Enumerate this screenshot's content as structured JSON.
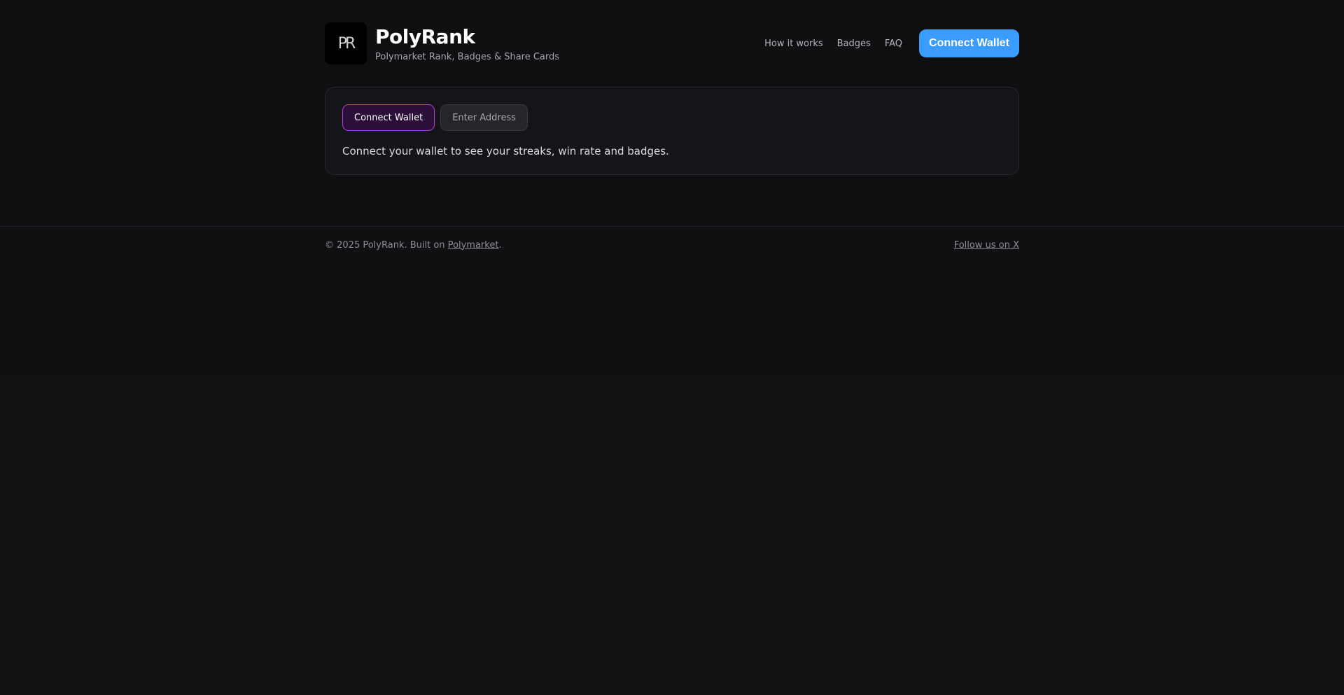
{
  "brand": {
    "logo_text": "PR",
    "title": "PolyRank",
    "tagline": "Polymarket Rank, Badges & Share Cards"
  },
  "nav": {
    "items": [
      {
        "label": "How it works"
      },
      {
        "label": "Badges"
      },
      {
        "label": "FAQ"
      }
    ],
    "cta_label": "Connect Wallet"
  },
  "card": {
    "tabs": [
      {
        "label": "Connect Wallet",
        "active": true
      },
      {
        "label": "Enter Address",
        "active": false
      }
    ],
    "message": "Connect your wallet to see your streaks, win rate and badges."
  },
  "footer": {
    "copyright_prefix": "© 2025 PolyRank. Built on ",
    "link_label": "Polymarket",
    "copyright_suffix": ".",
    "social_label": "Follow us on X"
  },
  "colors": {
    "background": "#0f1012",
    "accent_blue": "#3b9cff",
    "accent_purple": "#b43fd9"
  }
}
